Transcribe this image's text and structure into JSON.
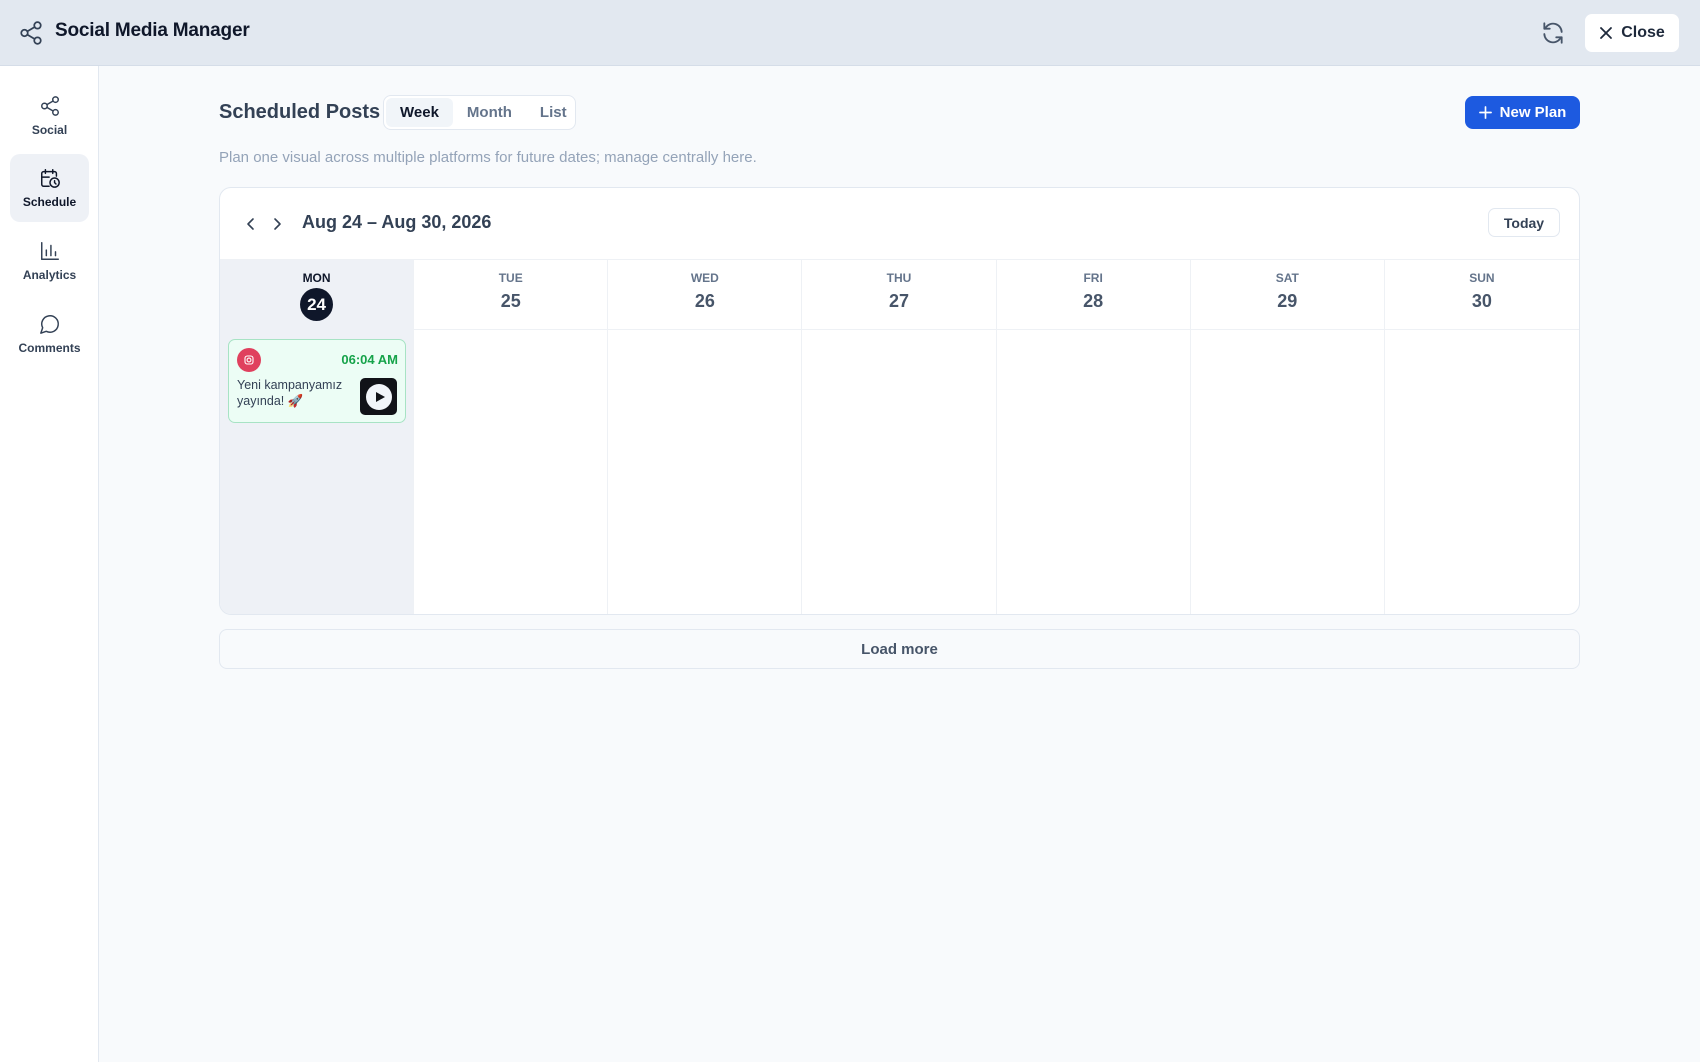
{
  "app": {
    "title": "Social Media Manager",
    "close_label": "Close",
    "icons": {
      "app": "share-icon",
      "refresh": "refresh-icon",
      "close": "close-icon"
    }
  },
  "sidebar": {
    "items": [
      {
        "label": "Social",
        "icon": "share-icon",
        "active": false
      },
      {
        "label": "Schedule",
        "icon": "calendar-clock-icon",
        "active": true
      },
      {
        "label": "Analytics",
        "icon": "bar-chart-icon",
        "active": false
      },
      {
        "label": "Comments",
        "icon": "chat-bubble-icon",
        "active": false
      }
    ]
  },
  "main": {
    "title": "Scheduled Posts",
    "views": [
      {
        "label": "Week",
        "active": true
      },
      {
        "label": "Month",
        "active": false
      },
      {
        "label": "List",
        "active": false
      }
    ],
    "new_plan_label": "New Plan",
    "subtitle": "Plan one visual across multiple platforms for future dates; manage centrally here.",
    "load_more_label": "Load more"
  },
  "calendar": {
    "range": "Aug 24 – Aug 30, 2026",
    "today_label": "Today",
    "days": [
      {
        "dow": "MON",
        "num": "24",
        "today": true
      },
      {
        "dow": "TUE",
        "num": "25",
        "today": false
      },
      {
        "dow": "WED",
        "num": "26",
        "today": false
      },
      {
        "dow": "THU",
        "num": "27",
        "today": false
      },
      {
        "dow": "FRI",
        "num": "28",
        "today": false
      },
      {
        "dow": "SAT",
        "num": "29",
        "today": false
      },
      {
        "dow": "SUN",
        "num": "30",
        "today": false
      }
    ],
    "post": {
      "platform": "instagram",
      "time": "06:04 AM",
      "text": "Yeni kampanyamız yayında! 🚀",
      "media": "video"
    }
  },
  "colors": {
    "accent": "#1d5ae0",
    "post_time": "#16a34a",
    "instagram": "#e0405e",
    "today_badge": "#0f172a"
  }
}
